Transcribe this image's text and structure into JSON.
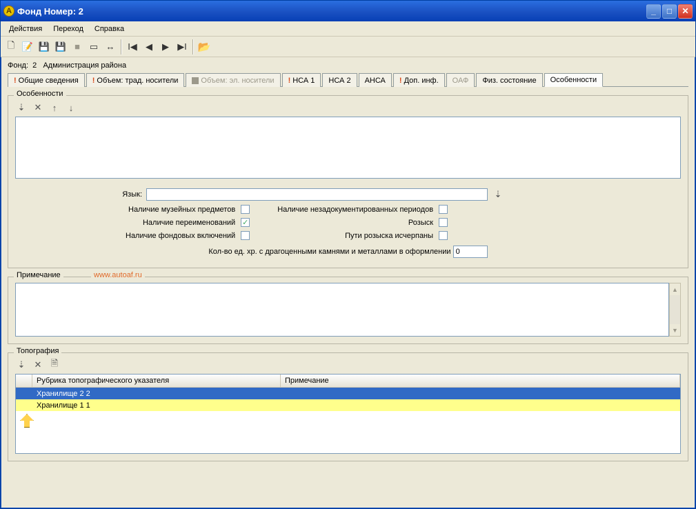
{
  "window": {
    "title": "Фонд Номер: 2"
  },
  "menu": {
    "actions": "Действия",
    "goto": "Переход",
    "help": "Справка"
  },
  "breadcrumb": {
    "pre": "Фонд:",
    "num": "2",
    "name": "Администрация района"
  },
  "tabs": {
    "general": "Общие сведения",
    "vol_trad": "Объем: трад. носители",
    "vol_el": "Объем: эл. носители",
    "nsa1": "НСА 1",
    "nsa2": "НСА 2",
    "ansa": "АНСА",
    "addinfo": "Доп. инф.",
    "oaf": "ОАФ",
    "phys": "Физ. состояние",
    "features": "Особенности"
  },
  "features": {
    "group_label": "Особенности",
    "lang_label": "Язык:",
    "lang_value": "",
    "checks": {
      "museum": "Наличие музейных предметов",
      "renames": "Наличие переименований",
      "inclusions": "Наличие фондовых включений",
      "undoc_periods": "Наличие незадокументированных периодов",
      "search": "Розыск",
      "search_exhausted": "Пути розыска исчерпаны",
      "renames_checked": true
    },
    "count_label": "Кол-во ед. хр. с драгоценными камнями и металлами в оформлении",
    "count_value": "0"
  },
  "note": {
    "group_label": "Примечание",
    "watermark": "www.autoaf.ru"
  },
  "topo": {
    "group_label": "Топография",
    "col_rubric": "Рубрика топографического указателя",
    "col_note": "Примечание",
    "rows": [
      {
        "rubric": "Хранилище 2 2",
        "note": "",
        "selected": true
      },
      {
        "rubric": "Хранилище 1 1",
        "note": "",
        "highlight": true
      }
    ]
  }
}
